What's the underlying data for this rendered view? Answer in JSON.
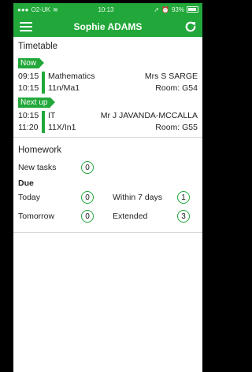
{
  "status": {
    "carrier": "O2-UK",
    "time": "10:13",
    "battery": "93%"
  },
  "appbar": {
    "title": "Sophie ADAMS",
    "menu_icon": "hamburger-menu-icon",
    "refresh_icon": "refresh-icon"
  },
  "timetable": {
    "heading": "Timetable",
    "now_label": "Now",
    "now": {
      "start": "09:15",
      "end": "10:15",
      "subject": "Mathematics",
      "class": "11n/Ma1",
      "teacher": "Mrs S SARGE",
      "room": "Room: G54"
    },
    "next_label": "Next up",
    "next": {
      "start": "10:15",
      "end": "11:20",
      "subject": "IT",
      "class": "11X/In1",
      "teacher": "Mr J JAVANDA-MCCALLA",
      "room": "Room: G55"
    }
  },
  "homework": {
    "heading": "Homework",
    "new_tasks_label": "New tasks",
    "new_tasks_count": "0",
    "due_label": "Due",
    "today_label": "Today",
    "today_count": "0",
    "within7_label": "Within 7 days",
    "within7_count": "1",
    "tomorrow_label": "Tomorrow",
    "tomorrow_count": "0",
    "extended_label": "Extended",
    "extended_count": "3"
  },
  "colors": {
    "accent": "#22a83a"
  }
}
